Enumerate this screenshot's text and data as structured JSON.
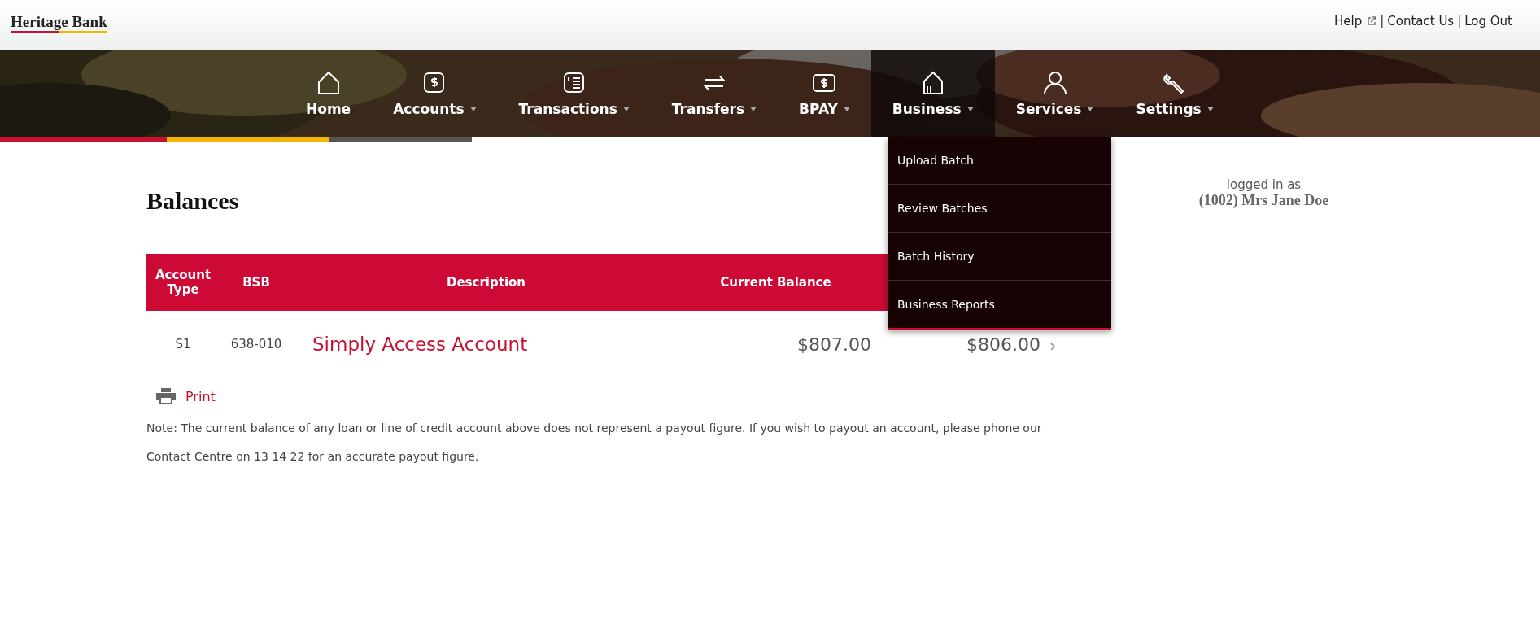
{
  "logo": "Heritage Bank",
  "top_links": [
    {
      "label": "Help",
      "external": true
    },
    {
      "label": "Contact Us",
      "external": false
    },
    {
      "label": "Log Out",
      "external": false
    }
  ],
  "link_separator": "|",
  "nav": [
    {
      "label": "Home",
      "caret": false,
      "selected": false
    },
    {
      "label": "Accounts",
      "caret": true,
      "selected": false
    },
    {
      "label": "Transactions",
      "caret": true,
      "selected": false
    },
    {
      "label": "Transfers",
      "caret": true,
      "selected": false
    },
    {
      "label": "BPAY",
      "caret": true,
      "selected": false
    },
    {
      "label": "Business",
      "caret": true,
      "selected": true
    },
    {
      "label": "Services",
      "caret": true,
      "selected": false
    },
    {
      "label": "Settings",
      "caret": true,
      "selected": false
    }
  ],
  "dropdown": [
    "Upload Batch",
    "Review Batches",
    "Batch History",
    "Business Reports"
  ],
  "title": "Balances",
  "table": {
    "columns": [
      "Account Type",
      "BSB",
      "Description",
      "Current Balance"
    ],
    "rows": [
      {
        "account_type": "S1",
        "bsb": "638-010",
        "description": "Simply Access Account",
        "current_balance": "$807.00",
        "column_5": "$806.00"
      }
    ]
  },
  "print": "Print",
  "note": "Note: The current balance of any loan or line of credit account above does not represent a payout figure. If you wish to payout an account, please phone our Contact Centre on 13 14 22 for an accurate payout figure.",
  "logged_in": {
    "label": "logged in as",
    "user": "(1002) Mrs Jane Doe"
  }
}
